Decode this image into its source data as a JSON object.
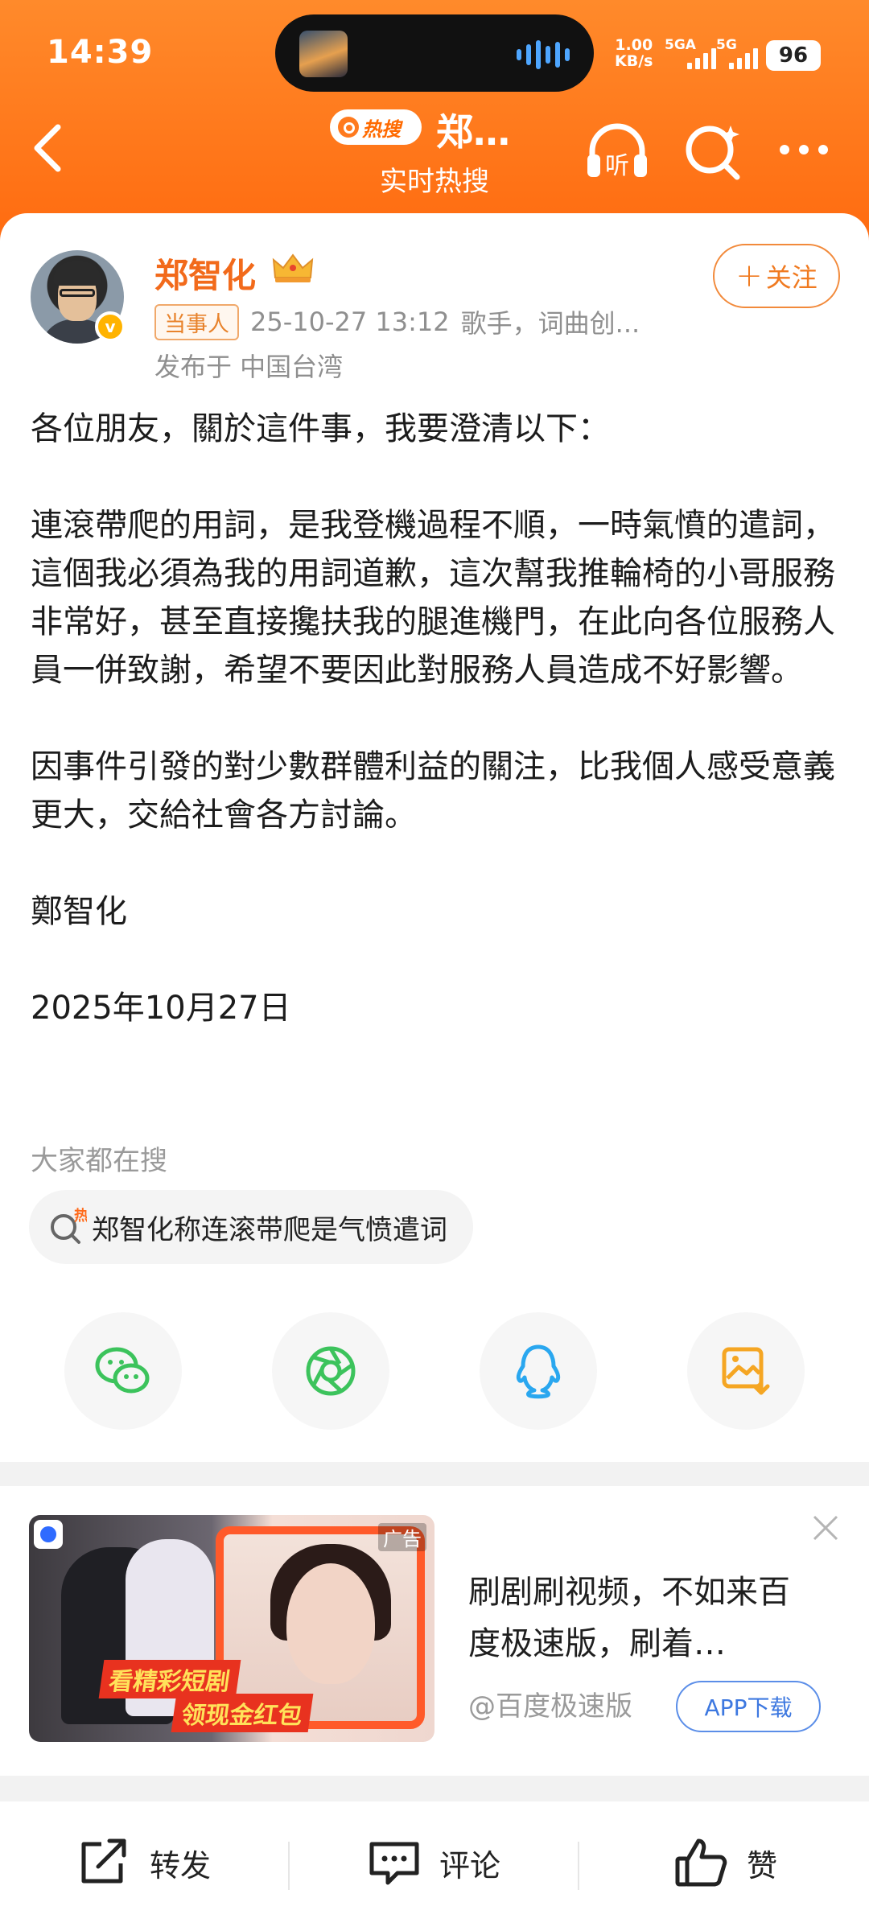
{
  "status_bar": {
    "time": "14:39",
    "net_rate": "1.00",
    "net_unit": "KB/s",
    "sim1": "5GA",
    "sim2": "5G",
    "battery": "96"
  },
  "nav": {
    "logo_label": "热搜",
    "title": "郑…",
    "subtitle": "实时热搜",
    "listen_label": "听"
  },
  "post": {
    "author": "郑智化",
    "tag": "当事人",
    "time": "25-10-27 13:12",
    "desc": "歌手，词曲创...",
    "location": "发布于 中国台湾",
    "follow_label": "关注",
    "paragraphs": [
      "各位朋友，關於這件事，我要澄清以下：",
      "連滾帶爬的用詞，是我登機過程不順，一時氣憤的遣詞，這個我必須為我的用詞道歉，這次幫我推輪椅的小哥服務非常好，甚至直接攙扶我的腿進機門，在此向各位服務人員一併致謝，希望不要因此對服務人員造成不好影響。",
      "因事件引發的對少數群體利益的關注，比我個人感受意義更大，交給社會各方討論。",
      "鄭智化",
      "2025年10月27日"
    ]
  },
  "search": {
    "heading": "大家都在搜",
    "chip_badge": "热",
    "chip_label": "郑智化称连滚带爬是气愤遣词"
  },
  "share": {
    "items": [
      "wechat-icon",
      "moments-icon",
      "qq-icon",
      "save-image-icon"
    ]
  },
  "ad": {
    "label": "广告",
    "banner_line1": "看精彩短剧",
    "banner_line2": "领现金红包",
    "title": "刷剧刷视频，不如来百度极速版，刷着…",
    "source": "@百度极速版",
    "button": "APP下载"
  },
  "bottom_bar": {
    "repost": "转发",
    "comment": "评论",
    "like": "赞"
  },
  "colors": {
    "accent": "#ff6b10",
    "author": "#f26a1b",
    "link_blue": "#3d78e0"
  }
}
